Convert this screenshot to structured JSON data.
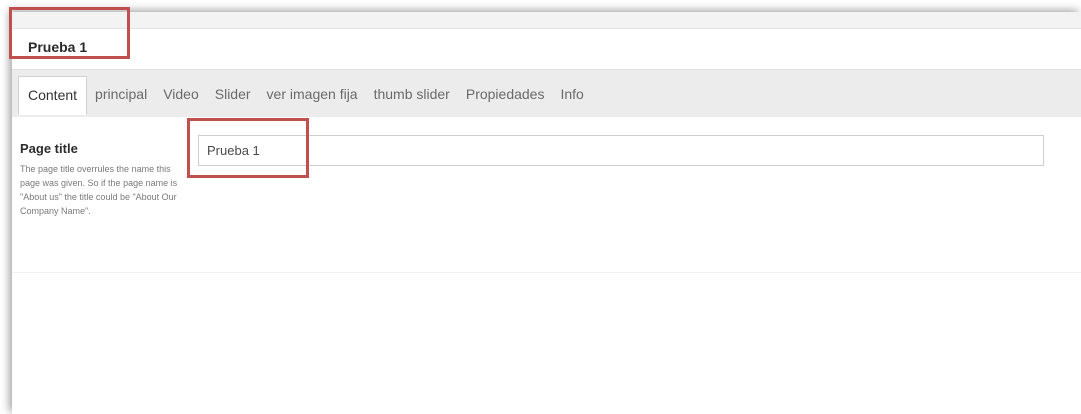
{
  "header": {
    "node_name": "Prueba 1"
  },
  "tabs": [
    {
      "label": "Content",
      "active": true
    },
    {
      "label": "principal",
      "active": false
    },
    {
      "label": "Video",
      "active": false
    },
    {
      "label": "Slider",
      "active": false
    },
    {
      "label": "ver imagen fija",
      "active": false
    },
    {
      "label": "thumb slider",
      "active": false
    },
    {
      "label": "Propiedades",
      "active": false
    },
    {
      "label": "Info",
      "active": false
    }
  ],
  "property": {
    "title": "Page title",
    "description": "The page title overrules the name this page was given. So if the page name is \"About us\" the title could be \"About Our Company Name\".",
    "value": "Prueba 1"
  },
  "colors": {
    "highlight": "#c0504d",
    "tab_bar": "#ececec"
  }
}
